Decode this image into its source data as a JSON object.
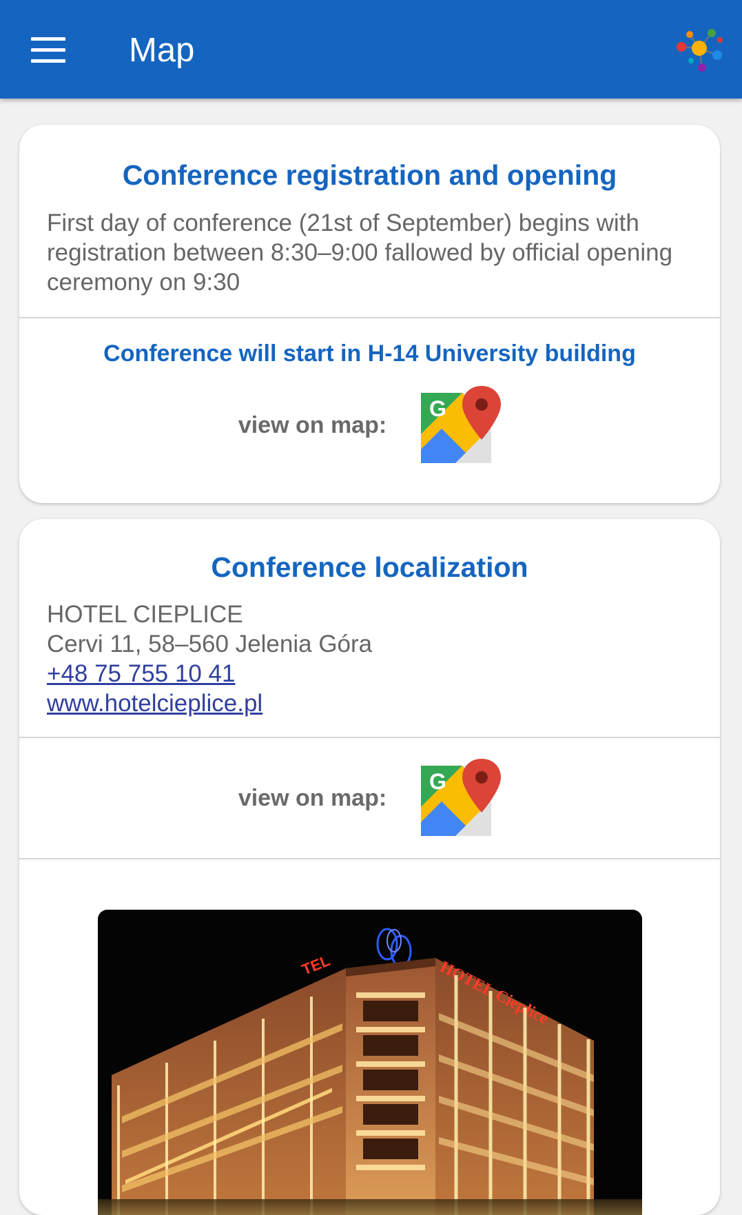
{
  "appbar": {
    "title": "Map",
    "menu_icon": "hamburger-menu-icon",
    "logo_icon": "molecule-logo-icon",
    "color": "#1565c0"
  },
  "card1": {
    "title": "Conference registration and opening",
    "body": "First day of conference (21st of September) begins with registration between 8:30–9:00 fallowed by official opening ceremony on 9:30",
    "subtitle": "Conference will start in H-14 University building",
    "map_label": "view on map:",
    "map_icon": "google-maps-icon"
  },
  "card2": {
    "title": "Conference localization",
    "address_name": "HOTEL CIEPLICE",
    "address_street": "Cervi 11, 58–560 Jelenia Góra",
    "phone": "+48 75 755 10 41",
    "website": "www.hotelcieplice.pl",
    "map_label": "view on map:",
    "map_icon": "google-maps-icon",
    "photo_sign_main": "HOTEL Cieplice",
    "photo_sign_side": "TEL"
  }
}
